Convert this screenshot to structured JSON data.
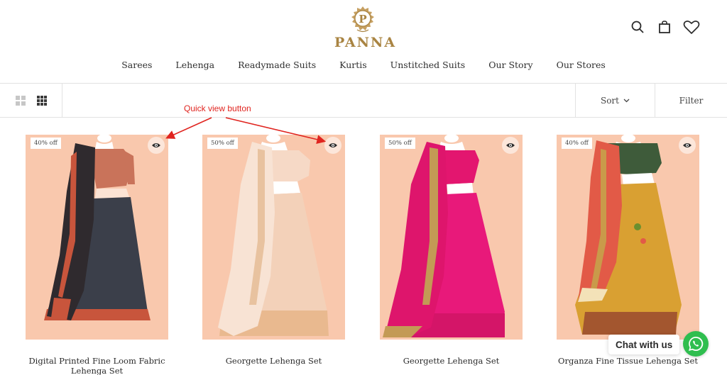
{
  "brand": {
    "name": "PANNA",
    "accent_color": "#a98442"
  },
  "header": {
    "icons": [
      "search-icon",
      "bag-icon",
      "heart-icon"
    ]
  },
  "nav": {
    "items": [
      "Sarees",
      "Lehenga",
      "Readymade Suits",
      "Kurtis",
      "Unstitched Suits",
      "Our Story",
      "Our Stores"
    ]
  },
  "toolbar": {
    "sort_label": "Sort",
    "filter_label": "Filter"
  },
  "annotation": {
    "label": "Quick view button",
    "color": "#e0241f"
  },
  "products": [
    {
      "badge": "40% off",
      "title": "Digital Printed Fine Loom Fabric Lehenga Set",
      "palette": {
        "top": "#c9735a",
        "skirt": "#3b3f4a",
        "dupatta": "#2f2a2e",
        "trim": "#c8553c"
      }
    },
    {
      "badge": "50% off",
      "title": "Georgette Lehenga Set",
      "palette": {
        "top": "#f6d9c6",
        "skirt": "#f3d1b9",
        "dupatta": "#f8e3d4",
        "trim": "#d9a77e"
      }
    },
    {
      "badge": "50% off",
      "title": "Georgette Lehenga Set",
      "palette": {
        "top": "#e3166f",
        "skirt": "#e8197a",
        "dupatta": "#de156c",
        "trim": "#c39a55"
      }
    },
    {
      "badge": "40% off",
      "title": "Organza Fine Tissue Lehenga Set",
      "palette": {
        "top": "#3e5b3a",
        "skirt": "#d9a032",
        "dupatta": "#e25a47",
        "trim": "#c99a4a"
      }
    }
  ],
  "product_bg": "#f9c8ad",
  "chat": {
    "label": "Chat with us",
    "color": "#2fbe4f"
  }
}
